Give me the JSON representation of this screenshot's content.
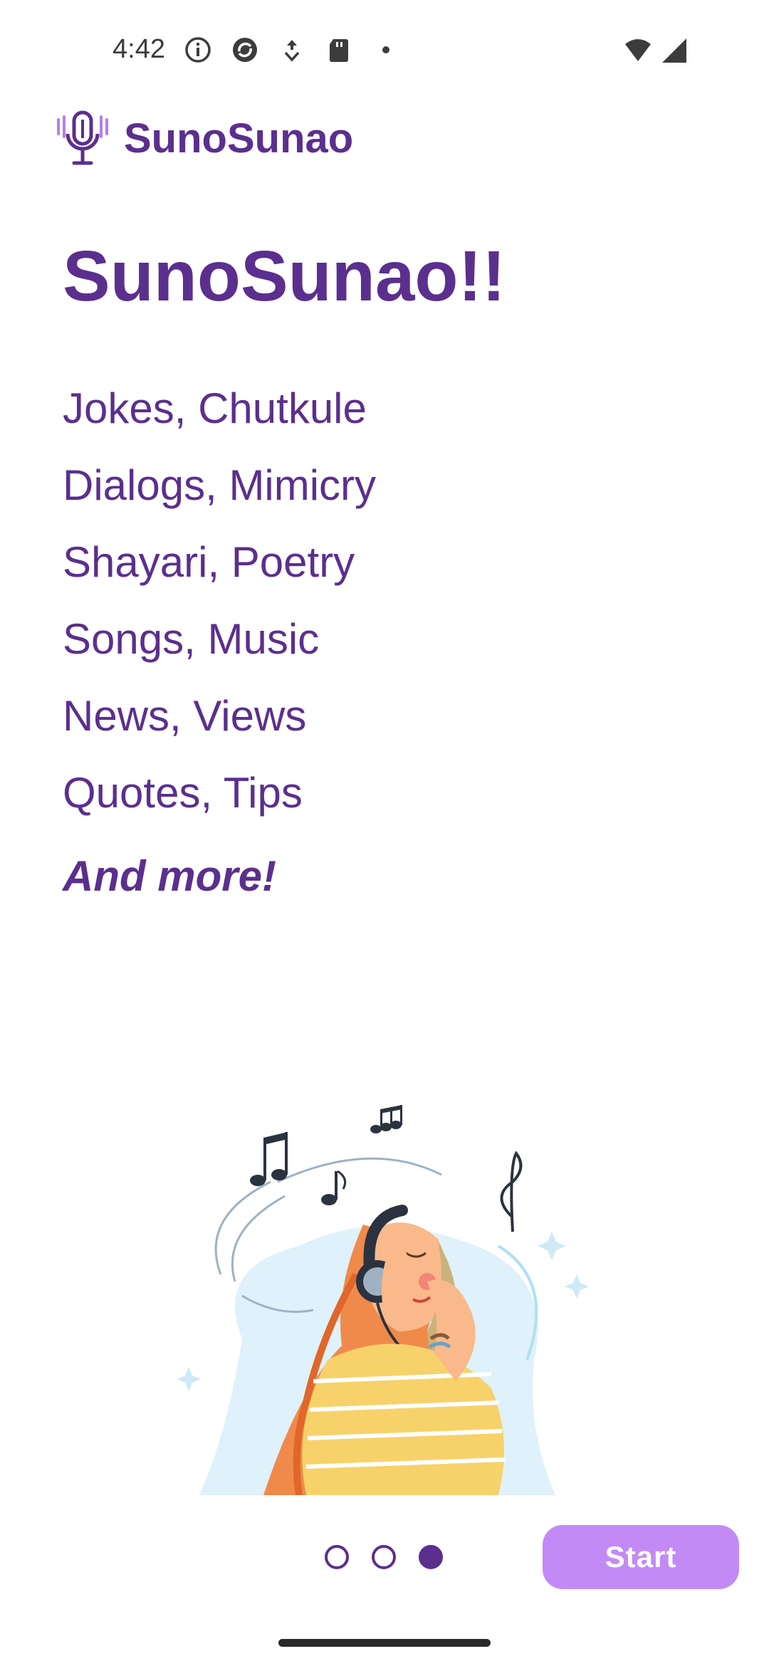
{
  "status_bar": {
    "time": "4:42",
    "left_icons": [
      "info-icon",
      "sync-icon",
      "download-icon",
      "sd-card-icon",
      "dot-icon"
    ],
    "right_icons": [
      "wifi-icon",
      "signal-icon"
    ]
  },
  "header": {
    "logo_icon": "microphone-icon",
    "app_name": "SunoSunao"
  },
  "hero": {
    "title": "SunoSunao!!"
  },
  "features": [
    "Jokes, Chutkule",
    "Dialogs, Mimicry",
    "Shayari, Poetry",
    "Songs, Music",
    "News, Views",
    "Quotes, Tips"
  ],
  "and_more": "And more!",
  "pager": {
    "total": 3,
    "active_index": 2
  },
  "start_button": {
    "label": "Start"
  },
  "colors": {
    "primary": "#5b2f8e",
    "button": "#c38af5",
    "logo_accent": "#b57ee6"
  }
}
